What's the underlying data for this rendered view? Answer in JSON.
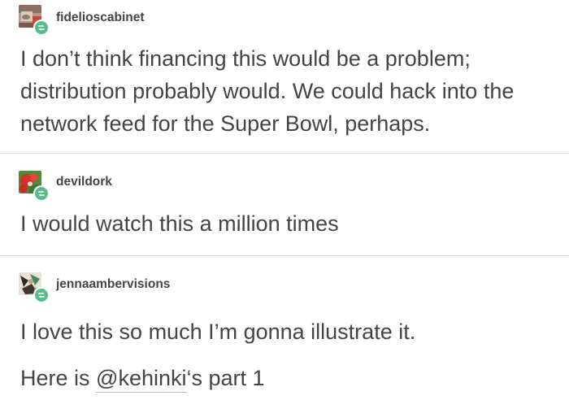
{
  "posts": [
    {
      "username": "fidelioscabinet",
      "avatar_icon": "avatar-photo-icon",
      "badge_icon": "reblog-icon",
      "badge_color": "#56bc8a",
      "body": "I don’t think financing this would be a problem; distribution probably would. We could hack into the network feed for the Super Bowl, perhaps."
    },
    {
      "username": "devildork",
      "avatar_icon": "avatar-photo-icon",
      "badge_icon": "reblog-icon",
      "body": "I would watch this a million times"
    },
    {
      "username": "jennaambervisions",
      "avatar_icon": "avatar-photo-icon",
      "badge_icon": "reblog-icon",
      "body": "I love this so much I’m gonna illustrate it.",
      "line2_prefix": "Here is ",
      "mention": "@kehinki",
      "line2_suffix": "‘s part 1"
    }
  ]
}
